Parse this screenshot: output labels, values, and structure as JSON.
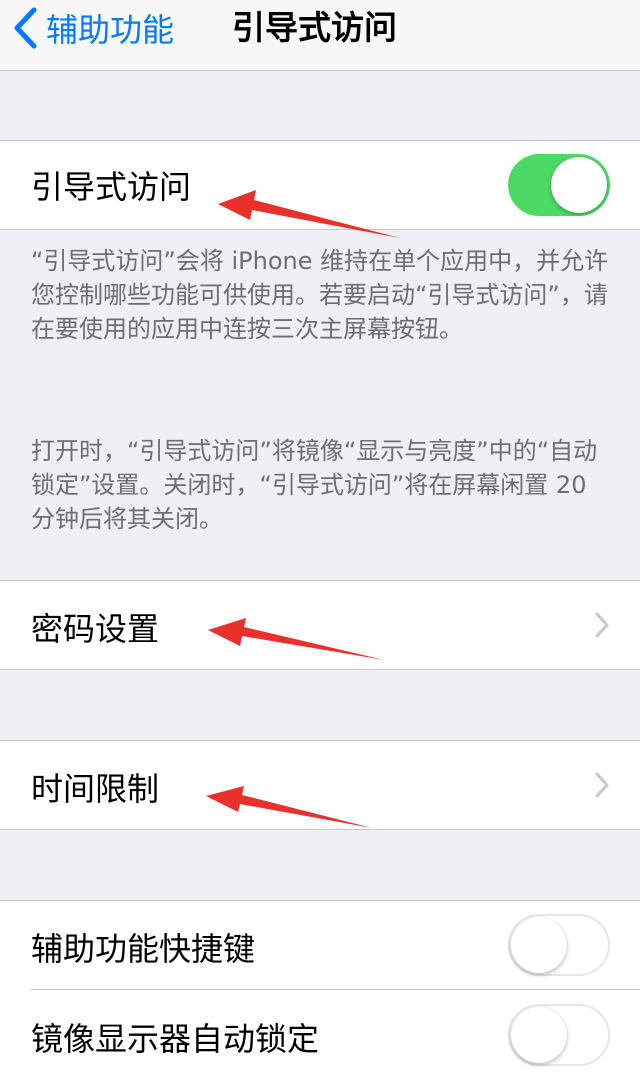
{
  "nav": {
    "back_label": "辅助功能",
    "title": "引导式访问",
    "back_icon": "chevron-left-icon"
  },
  "guided_access": {
    "label": "引导式访问",
    "toggle_state": "on"
  },
  "description": {
    "paragraph1": "“引导式访问”会将 iPhone 维持在单个应用中，并允许您控制哪些功能可供使用。若要启动“引导式访问”，请在要使用的应用中连按三次主屏幕按钮。",
    "paragraph2": "打开时，“引导式访问”将镜像“显示与亮度”中的“自动锁定”设置。关闭时，“引导式访问”将在屏幕闲置 20 分钟后将其关闭。"
  },
  "passcode_settings": {
    "label": "密码设置",
    "icon": "chevron-right-icon"
  },
  "time_limits": {
    "label": "时间限制",
    "icon": "chevron-right-icon"
  },
  "accessibility_shortcut": {
    "label": "辅助功能快捷键",
    "toggle_state": "off"
  },
  "mirror_auto_lock": {
    "label": "镜像显示器自动锁定",
    "toggle_state": "off"
  },
  "colors": {
    "accent": "#007aff",
    "toggle_on": "#4cd964",
    "background": "#efeff4",
    "annotation_red": "#e8312a"
  }
}
